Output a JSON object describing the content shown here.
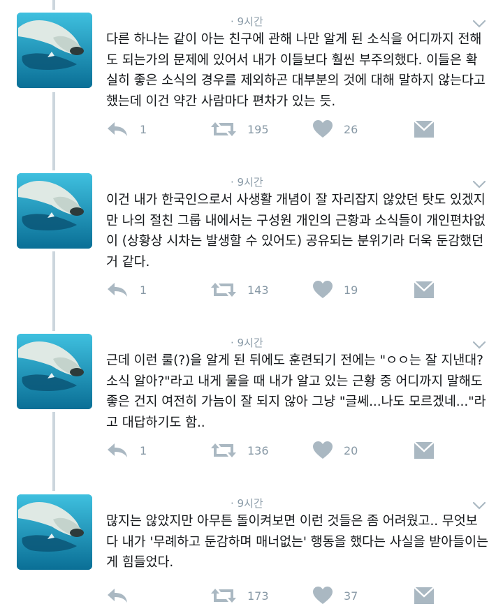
{
  "tweets": [
    {
      "time": "· 9시간",
      "text": "다른 하나는 같이 아는 친구에 관해 나만 알게 된 소식을 어디까지 전해도 되는가의 문제에 있어서 내가 이들보다 훨씬 부주의했다. 이들은 확실히 좋은 소식의 경우를 제외하곤 대부분의 것에 대해 말하지 않는다고 했는데 이건 약간 사람마다 편차가 있는 듯.",
      "replies": "1",
      "retweets": "195",
      "likes": "26"
    },
    {
      "time": "· 9시간",
      "text": "이건 내가 한국인으로서 사생활 개념이 잘 자리잡지 않았던 탓도 있겠지만 나의 절친 그룹 내에서는 구성원 개인의 근황과 소식들이 개인편차없이 (상황상 시차는 발생할 수 있어도) 공유되는 분위기라 더욱 둔감했던 거 같다.",
      "replies": "1",
      "retweets": "143",
      "likes": "19"
    },
    {
      "time": "· 9시간",
      "text": "근데 이런 룰(?)을 알게 된 뒤에도 훈련되기 전에는 \"ㅇㅇ는 잘 지낸대? 소식 알아?\"라고 내게 물을 때 내가 알고 있는 근황 중 어디까지 말해도 좋은 건지 여전히 가늠이 잘 되지 않아 그냥 \"글쎄...나도 모르겠네...\"라고 대답하기도 함..",
      "replies": "1",
      "retweets": "136",
      "likes": "20"
    },
    {
      "time": "· 9시간",
      "text": "많지는 않았지만 아무튼 돌이켜보면 이런 것들은 좀 어려웠고.. 무엇보다 내가 '무례하고 둔감하며 매너없는' 행동을 했다는 사실을 받아들이는 게 힘들었다.",
      "replies": "",
      "retweets": "173",
      "likes": "37"
    }
  ],
  "icons": {
    "reply": "reply-icon",
    "retweet": "retweet-icon",
    "like": "heart-icon",
    "dm": "envelope-icon",
    "caret": "chevron-down-icon"
  },
  "colors": {
    "icon": "#aab8c2",
    "meta": "#8899a6",
    "thread_line": "#ccd6dd",
    "text": "#14171a"
  }
}
